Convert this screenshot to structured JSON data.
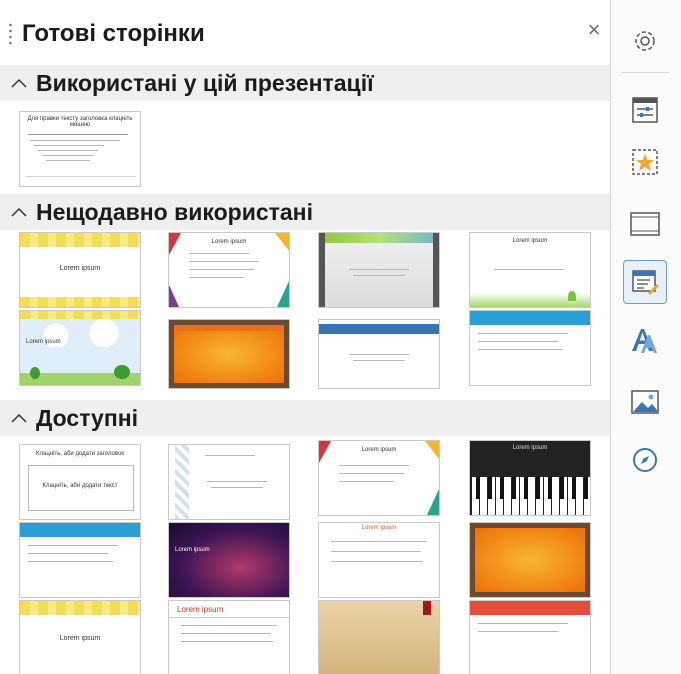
{
  "panel": {
    "title": "Готові сторінки",
    "close_label": "×"
  },
  "sections": [
    {
      "label": "Використані у цій презентації"
    },
    {
      "label": "Нещодавно використані"
    },
    {
      "label": "Доступні"
    }
  ],
  "thumb_texts": {
    "used_title": "Для правки тексту заголовка клацніть мишею",
    "used_bullets": [
      "Для редагування структури тексту клацніть мишею",
      "Другий рівень структури",
      "Третій рівень структури",
      "Четвертий рівень",
      "П'ятий рівень"
    ],
    "lorem": "Lorem ipsum",
    "lorem_body": "dolor sit amet, consectetur adipiscing elit",
    "add_title": "Клацніть, аби додати заголовок",
    "add_text": "Клацніть, аби додати текст"
  },
  "sidebar": {
    "items": [
      {
        "name": "gear-icon"
      },
      {
        "name": "properties-icon"
      },
      {
        "name": "slide-transition-icon"
      },
      {
        "name": "slides-icon"
      },
      {
        "name": "master-slides-icon"
      },
      {
        "name": "styles-icon"
      },
      {
        "name": "gallery-icon"
      },
      {
        "name": "navigator-icon"
      }
    ]
  },
  "colors": {
    "accent": "#6f9bd1",
    "section_bg": "#efefef"
  }
}
